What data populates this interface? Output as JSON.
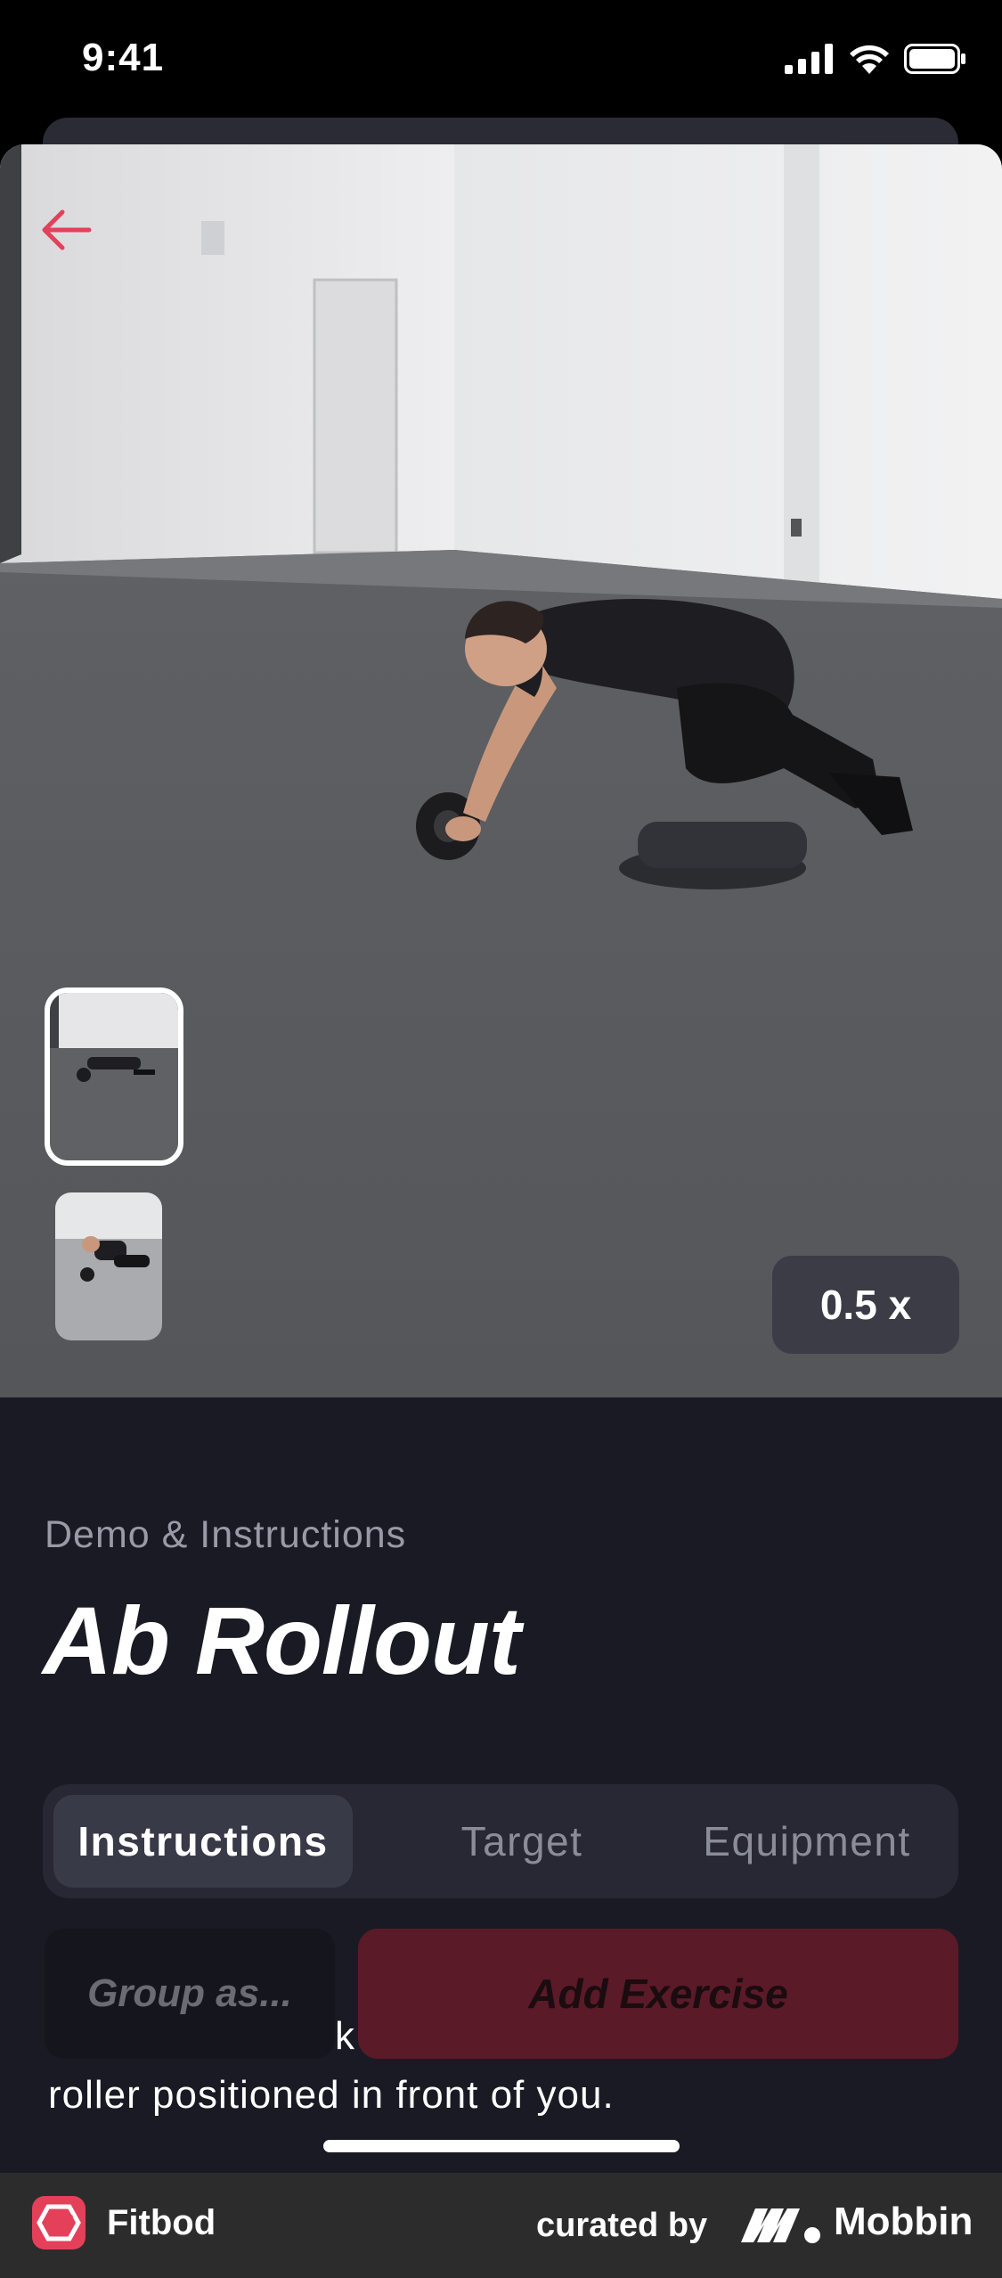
{
  "status_bar": {
    "time": "9:41"
  },
  "video": {
    "speed_label": "0.5 x",
    "back_icon": "arrow-left-icon",
    "accent_color": "#e4405a"
  },
  "exercise": {
    "subtitle": "Demo & Instructions",
    "title": "Ab Rollout"
  },
  "tabs": [
    {
      "label": "Instructions",
      "active": true
    },
    {
      "label": "Target",
      "active": false
    },
    {
      "label": "Equipment",
      "active": false
    }
  ],
  "instructions": {
    "line1_fragment": "k",
    "line2": "roller positioned in front of you."
  },
  "actions": {
    "group_label": "Group as...",
    "add_label": "Add Exercise"
  },
  "footer": {
    "app_name": "Fitbod",
    "curated_by": "curated by",
    "brand": "Mobbin"
  }
}
